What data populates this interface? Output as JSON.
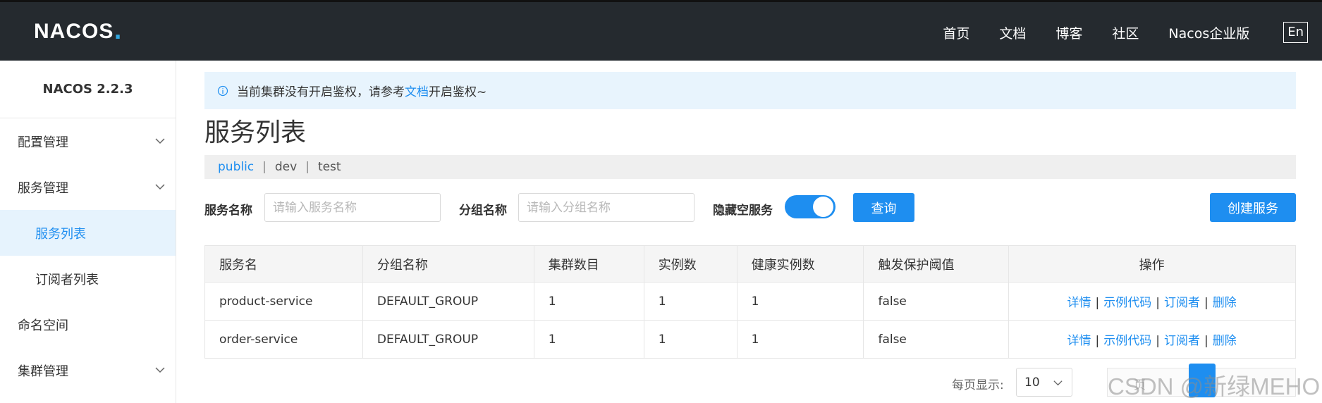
{
  "header": {
    "logo_text": "NACOS",
    "nav": [
      "首页",
      "文档",
      "博客",
      "社区",
      "Nacos企业版"
    ],
    "lang": "En"
  },
  "sidebar": {
    "version": "NACOS 2.2.3",
    "items": [
      {
        "label": "配置管理",
        "expandable": true
      },
      {
        "label": "服务管理",
        "expandable": true
      },
      {
        "label": "服务列表",
        "active": true
      },
      {
        "label": "订阅者列表"
      },
      {
        "label": "命名空间"
      },
      {
        "label": "集群管理",
        "expandable": true
      }
    ]
  },
  "notice": {
    "prefix": "当前集群没有开启鉴权，请参考",
    "link": "文档",
    "suffix": "开启鉴权~"
  },
  "page_title": "服务列表",
  "namespaces": [
    "public",
    "dev",
    "test"
  ],
  "filter": {
    "service_name_label": "服务名称",
    "service_name_placeholder": "请输入服务名称",
    "group_name_label": "分组名称",
    "group_name_placeholder": "请输入分组名称",
    "hide_empty_label": "隐藏空服务",
    "hide_empty_on": true,
    "query_label": "查询",
    "create_label": "创建服务"
  },
  "table": {
    "headers": [
      "服务名",
      "分组名称",
      "集群数目",
      "实例数",
      "健康实例数",
      "触发保护阈值",
      "操作"
    ],
    "rows": [
      [
        "product-service",
        "DEFAULT_GROUP",
        "1",
        "1",
        "1",
        "false"
      ],
      [
        "order-service",
        "DEFAULT_GROUP",
        "1",
        "1",
        "1",
        "false"
      ]
    ],
    "actions": [
      "详情",
      "示例代码",
      "订阅者",
      "删除"
    ]
  },
  "pager": {
    "page_size_label": "每页显示:",
    "page_size": "10",
    "hint": "页"
  },
  "watermark": "CSDN @新绿MEHO",
  "colors": {
    "header_bg": "#252a2f",
    "primary": "#1e8ef0",
    "notice_bg": "#e8f4fd",
    "active_bg": "#e6f3fd"
  }
}
